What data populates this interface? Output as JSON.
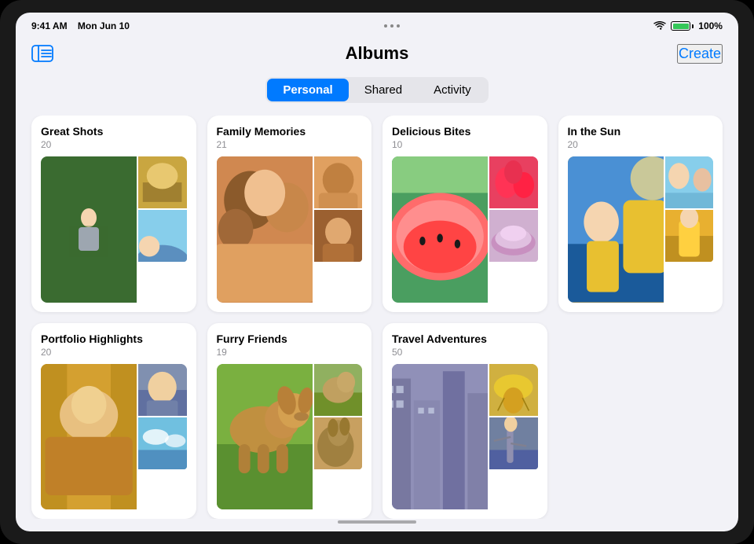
{
  "device": {
    "time": "9:41 AM",
    "date": "Mon Jun 10",
    "battery": "100%",
    "battery_level": 100
  },
  "header": {
    "title": "Albums",
    "create_label": "Create"
  },
  "tabs": [
    {
      "id": "personal",
      "label": "Personal",
      "active": true
    },
    {
      "id": "shared",
      "label": "Shared",
      "active": false
    },
    {
      "id": "activity",
      "label": "Activity",
      "active": false
    }
  ],
  "albums": [
    {
      "id": "great-shots",
      "title": "Great Shots",
      "count": "20",
      "colors": [
        "#3d6b35",
        "#c9a640",
        "#5b8fbf",
        "#7a5c3c",
        "#1f5c8a",
        "#e0d0a0"
      ]
    },
    {
      "id": "family-memories",
      "title": "Family Memories",
      "count": "21",
      "colors": [
        "#c97c40",
        "#9b6030",
        "#e8a870",
        "#7a4020",
        "#d4855a",
        "#b86a30"
      ]
    },
    {
      "id": "delicious-bites",
      "title": "Delicious Bites",
      "count": "10",
      "colors": [
        "#5ba85b",
        "#e84040",
        "#f48080",
        "#c860a0",
        "#7ad870",
        "#d8e870"
      ]
    },
    {
      "id": "in-the-sun",
      "title": "In the Sun",
      "count": "20",
      "colors": [
        "#e8b030",
        "#4090c8",
        "#d87030",
        "#70a0e0",
        "#e8d080",
        "#2870b0"
      ]
    },
    {
      "id": "portfolio-highlights",
      "title": "Portfolio Highlights",
      "count": "20",
      "colors": [
        "#d4a030",
        "#c06040",
        "#8090b0",
        "#4870a0",
        "#d0c880",
        "#6890c0"
      ]
    },
    {
      "id": "furry-friends",
      "title": "Furry Friends",
      "count": "19",
      "colors": [
        "#7ab040",
        "#c09060",
        "#d4a850",
        "#8a6030",
        "#90b870",
        "#c8a060"
      ]
    },
    {
      "id": "travel-adventures",
      "title": "Travel Adventures",
      "count": "50",
      "colors": [
        "#7080a0",
        "#d0b040",
        "#9080a8",
        "#4870a0",
        "#d0c060",
        "#6080b0"
      ]
    }
  ]
}
